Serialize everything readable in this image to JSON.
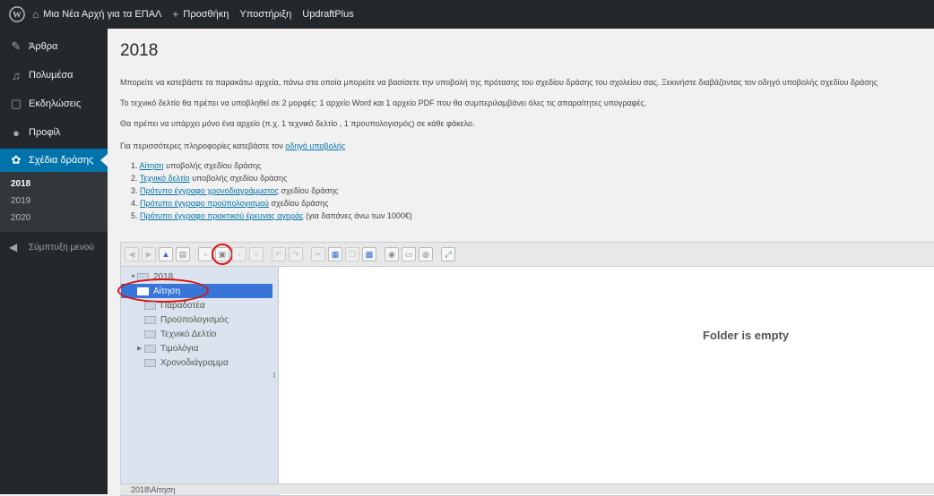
{
  "adminbar": {
    "site_name": "Μια Νέα Αρχή για τα ΕΠΑΛ",
    "new_label": "Προσθήκη",
    "support_label": "Υποστήριξη",
    "updraft_label": "UpdraftPlus"
  },
  "sidebar": {
    "items": [
      {
        "label": "Άρθρα",
        "icon": "pin-icon"
      },
      {
        "label": "Πολυμέσα",
        "icon": "media-icon"
      },
      {
        "label": "Εκδηλώσεις",
        "icon": "calendar-icon"
      },
      {
        "label": "Προφίλ",
        "icon": "user-icon"
      },
      {
        "label": "Σχέδια δράσης",
        "icon": "gear-icon"
      }
    ],
    "submenu": [
      "2018",
      "2019",
      "2020"
    ],
    "collapse_label": "Σύμπτυξη μενού"
  },
  "page": {
    "title": "2018",
    "p1": "Μπορείτε να κατεβάστε τα παρακάτω αρχεία, πάνω στα οποία μπορείτε να βασίσετε την υποβολή της πρότασης του σχεδίου δράσης του σχολείου σας. Ξεκινήστε διαβάζοντας τον οδηγό υποβολής σχεδίου δράσης",
    "p2": "Το τεχνικό δελτίο θα πρέπει να υποβληθεί σε 2 μορφές: 1 αρχείο Word και 1 αρχείο PDF που θα συμπεριλαμβάνει όλες τις απαραίτητες υπογραφές.",
    "p3": "Θα πρέπει να υπάρχει μόνο ένα αρχείο (π.χ. 1 τεχνικό δελτίο , 1 προυπολογισμός) σε κάθε φάκελο.",
    "p4_prefix": "Για περισσότερες πληροφορίες κατεβάστε τον ",
    "p4_link": "οδηγό υποβολής",
    "links": [
      {
        "num": "1. ",
        "link": "Αίτηση",
        "rest": " υποβολής σχεδίου δράσης"
      },
      {
        "num": "2. ",
        "link": "Τεχνικό δελτίο",
        "rest": " υποβολής σχεδίου δράσης"
      },
      {
        "num": "3. ",
        "link": "Πρότυπο έγγραφο χρονοδιαγράμματος",
        "rest": " σχεδίου δράσης"
      },
      {
        "num": "4. ",
        "link": "Πρότυπο έγγραφο προϋπολογισμού",
        "rest": " σχεδίου δράσης"
      },
      {
        "num": "5. ",
        "link": "Πρότυπο έγγραφο πρακτικού έρευνας αγοράς",
        "rest": " (για δαπάνες άνω των 1000€)"
      }
    ]
  },
  "filemanager": {
    "tree_root": "2018",
    "folders": [
      "Αίτηση",
      "Παραδοτέα",
      "Προϋπολογισμός",
      "Τεχνικό Δελτίο",
      "Τιμολόγια",
      "Χρονοδιάγραμμα"
    ],
    "empty_text": "Folder is empty",
    "status_path": "2018\\Αίτηση"
  },
  "colors": {
    "adminbar": "#23282d",
    "active_menu": "#0073aa",
    "selected_folder": "#3875d7",
    "highlight_circle": "#dd1111"
  }
}
